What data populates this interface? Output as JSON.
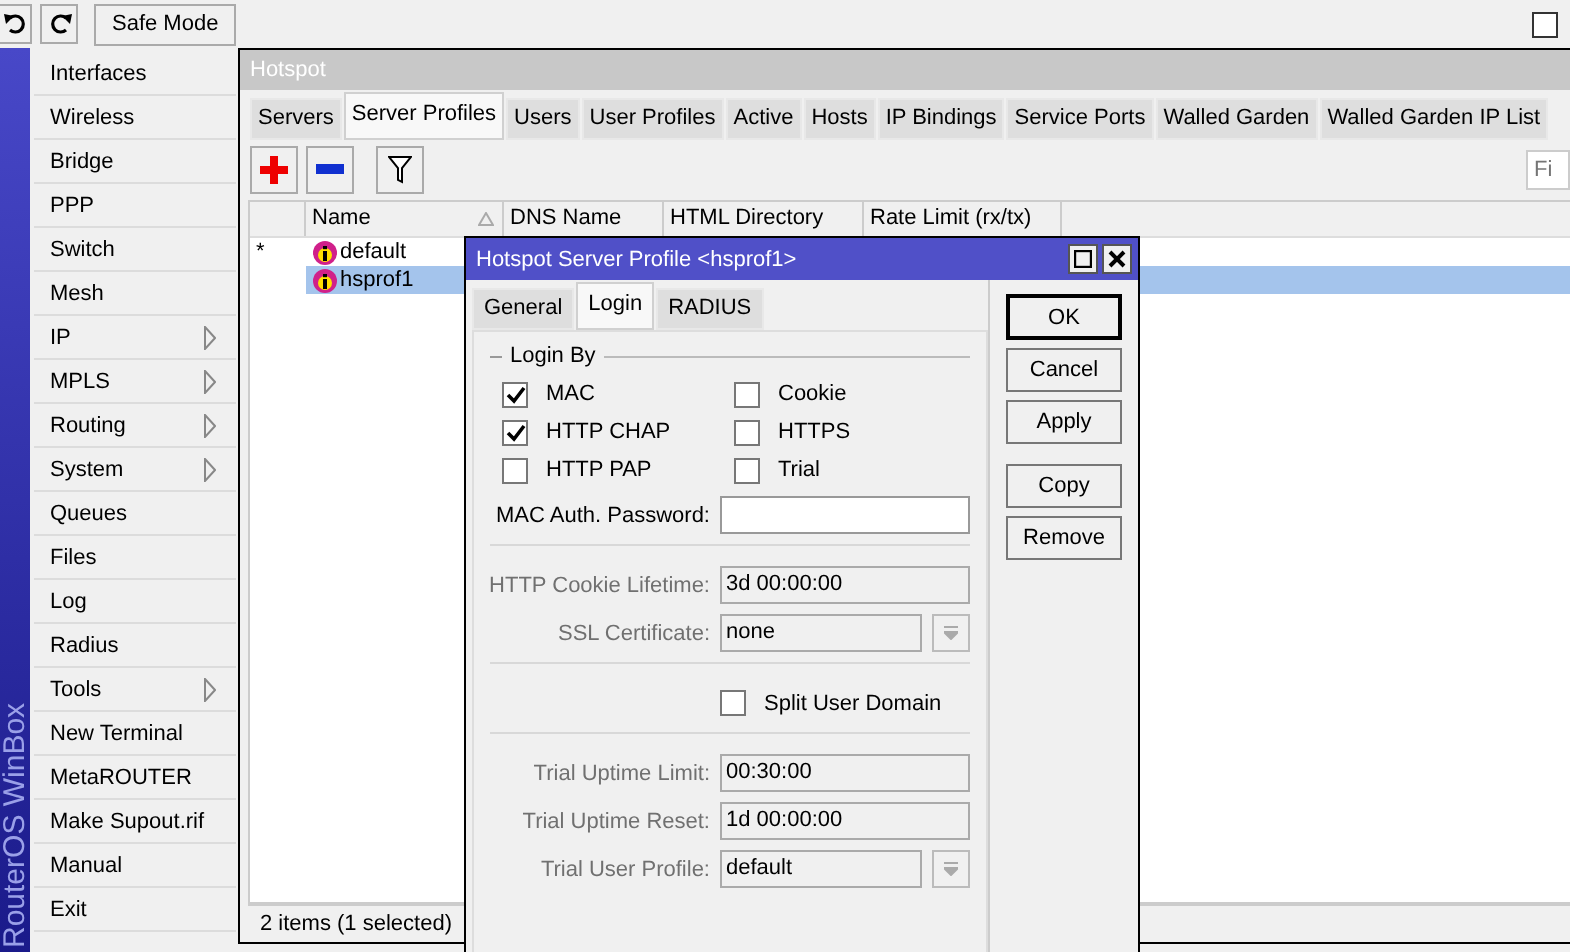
{
  "toolbar": {
    "safe_mode": "Safe Mode",
    "hide_menus_checked": false
  },
  "sidebar": {
    "brand": "RouterOS WinBox",
    "items": [
      {
        "label": "Interfaces",
        "submenu": false
      },
      {
        "label": "Wireless",
        "submenu": false
      },
      {
        "label": "Bridge",
        "submenu": false
      },
      {
        "label": "PPP",
        "submenu": false
      },
      {
        "label": "Switch",
        "submenu": false
      },
      {
        "label": "Mesh",
        "submenu": false
      },
      {
        "label": "IP",
        "submenu": true
      },
      {
        "label": "MPLS",
        "submenu": true
      },
      {
        "label": "Routing",
        "submenu": true
      },
      {
        "label": "System",
        "submenu": true
      },
      {
        "label": "Queues",
        "submenu": false
      },
      {
        "label": "Files",
        "submenu": false
      },
      {
        "label": "Log",
        "submenu": false
      },
      {
        "label": "Radius",
        "submenu": false
      },
      {
        "label": "Tools",
        "submenu": true
      },
      {
        "label": "New Terminal",
        "submenu": false
      },
      {
        "label": "MetaROUTER",
        "submenu": false
      },
      {
        "label": "Make Supout.rif",
        "submenu": false
      },
      {
        "label": "Manual",
        "submenu": false
      },
      {
        "label": "Exit",
        "submenu": false
      }
    ]
  },
  "hotspot": {
    "title": "Hotspot",
    "tabs": [
      {
        "label": "Servers",
        "selected": false
      },
      {
        "label": "Server Profiles",
        "selected": true
      },
      {
        "label": "Users",
        "selected": false
      },
      {
        "label": "User Profiles",
        "selected": false
      },
      {
        "label": "Active",
        "selected": false
      },
      {
        "label": "Hosts",
        "selected": false
      },
      {
        "label": "IP Bindings",
        "selected": false
      },
      {
        "label": "Service Ports",
        "selected": false
      },
      {
        "label": "Walled Garden",
        "selected": false
      },
      {
        "label": "Walled Garden IP List",
        "selected": false
      }
    ],
    "filter_placeholder": "Fi",
    "columns": [
      "Name",
      "DNS Name",
      "HTML Directory",
      "Rate Limit (rx/tx)"
    ],
    "rows": [
      {
        "flag": "*",
        "name": "default",
        "selected": false
      },
      {
        "name": "hsprof1",
        "selected": true
      }
    ],
    "status": "2 items (1 selected)"
  },
  "dialog": {
    "title": "Hotspot Server Profile <hsprof1>",
    "tabs": [
      {
        "label": "General",
        "selected": false
      },
      {
        "label": "Login",
        "selected": true
      },
      {
        "label": "RADIUS",
        "selected": false
      }
    ],
    "group_title": "Login By",
    "login_by": [
      {
        "label": "MAC",
        "checked": true
      },
      {
        "label": "Cookie",
        "checked": false
      },
      {
        "label": "HTTP CHAP",
        "checked": true
      },
      {
        "label": "HTTPS",
        "checked": false
      },
      {
        "label": "HTTP PAP",
        "checked": false
      },
      {
        "label": "Trial",
        "checked": false
      }
    ],
    "sections": [
      {
        "fields": [
          {
            "kind": "text",
            "label": "MAC Auth. Password:",
            "disabled": false
          }
        ]
      },
      {
        "fields": [
          {
            "kind": "text",
            "label": "HTTP Cookie Lifetime:",
            "value": "3d 00:00:00",
            "disabled": true
          },
          {
            "kind": "select",
            "label": "SSL Certificate:",
            "value": "none",
            "disabled": true
          }
        ]
      },
      {
        "fields": [
          {
            "kind": "checkbox",
            "label": "Split User Domain",
            "checked": false,
            "disabled": false
          }
        ]
      },
      {
        "fields": [
          {
            "kind": "text",
            "label": "Trial Uptime Limit:",
            "value": "00:30:00",
            "disabled": true
          },
          {
            "kind": "text",
            "label": "Trial Uptime Reset:",
            "value": "1d 00:00:00",
            "disabled": true
          },
          {
            "kind": "select",
            "label": "Trial User Profile:",
            "value": "default",
            "disabled": true
          }
        ]
      }
    ],
    "buttons": [
      {
        "label": "OK",
        "default": true
      },
      {
        "label": "Cancel",
        "default": false
      },
      {
        "label": "Apply",
        "default": false
      },
      {
        "label": "Copy",
        "default": false
      },
      {
        "label": "Remove",
        "default": false
      }
    ]
  }
}
